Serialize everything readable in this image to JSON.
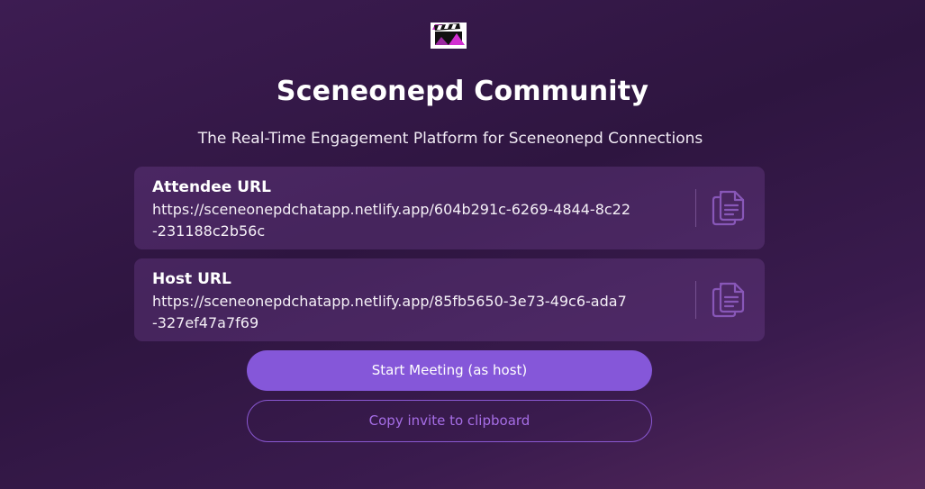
{
  "app": {
    "title": "Sceneonepd Community",
    "subtitle": "The Real-Time Engagement Platform for Sceneonepd Connections",
    "logo_icon": "clapperboard-icon"
  },
  "attendee": {
    "label": "Attendee URL",
    "url": "https://sceneonepdchatapp.netlify.app/604b291c-6269-4844-8c22\n-231188c2b56c",
    "copy_icon": "copy-icon"
  },
  "host": {
    "label": "Host URL",
    "url": "https://sceneonepdchatapp.netlify.app/85fb5650-3e73-49c6-ada7\n-327ef47a7f69",
    "copy_icon": "copy-icon"
  },
  "actions": {
    "start_label": "Start Meeting (as host)",
    "copy_invite_label": "Copy invite to clipboard"
  },
  "colors": {
    "accent": "#8557d9",
    "outline": "#8a58d2",
    "outline_text": "#a66ee6",
    "card_background": "#4a2a62"
  }
}
